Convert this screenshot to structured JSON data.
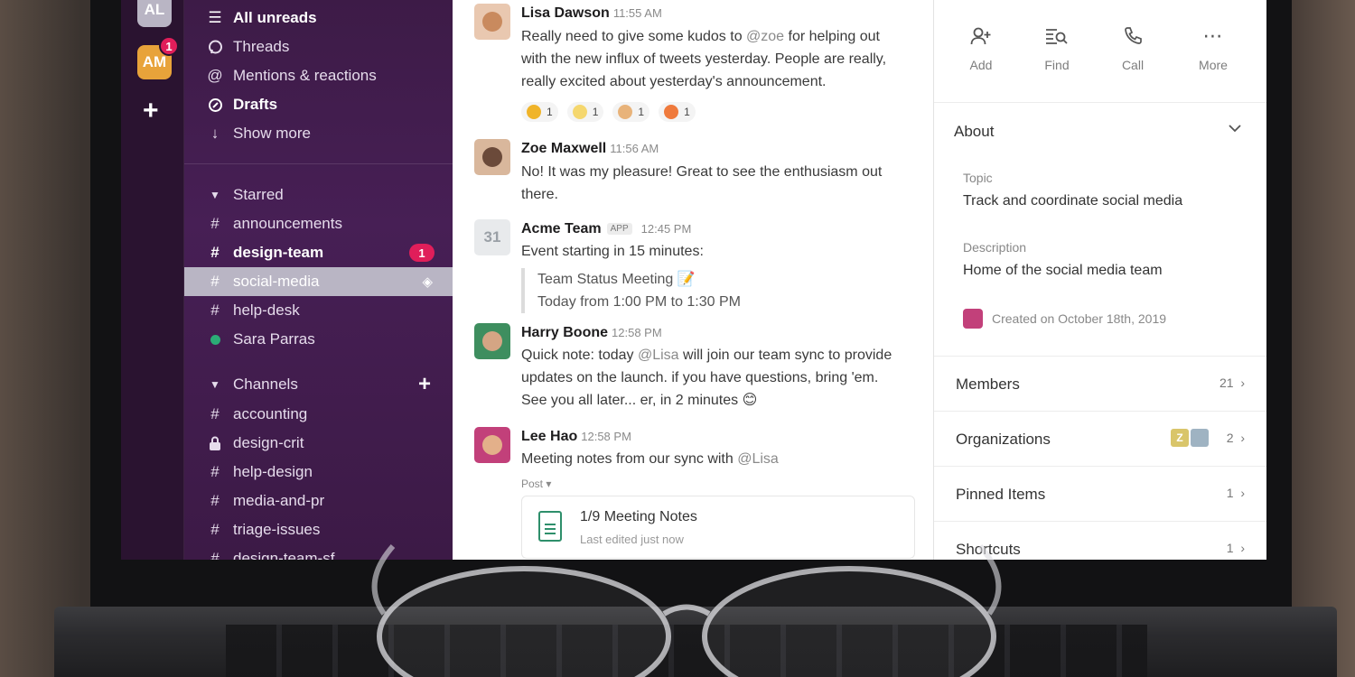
{
  "workspaces": [
    {
      "initials": "AL",
      "color": "#b9b5c4"
    },
    {
      "initials": "AM",
      "color": "#e8a33a",
      "badge": "1"
    }
  ],
  "rail": {
    "add_label": "+"
  },
  "sidebar": {
    "top_items": [
      {
        "label": "All unreads",
        "icon": "all-unreads-icon"
      },
      {
        "label": "Threads",
        "icon": "threads-icon"
      },
      {
        "label": "Mentions & reactions",
        "icon": "mentions-icon"
      },
      {
        "label": "Drafts",
        "icon": "drafts-icon"
      },
      {
        "label": "Show more",
        "icon": "arrow-down-icon"
      }
    ],
    "starred": {
      "title": "Starred",
      "items": [
        {
          "label": "announcements",
          "icon": "hash"
        },
        {
          "label": "design-team",
          "icon": "hash",
          "badge": "1"
        },
        {
          "label": "social-media",
          "icon": "hash",
          "active": true
        },
        {
          "label": "help-desk",
          "icon": "hash"
        },
        {
          "label": "Sara Parras",
          "icon": "presence"
        }
      ]
    },
    "channels": {
      "title": "Channels",
      "items": [
        {
          "label": "accounting",
          "icon": "hash"
        },
        {
          "label": "design-crit",
          "icon": "lock"
        },
        {
          "label": "help-design",
          "icon": "hash"
        },
        {
          "label": "media-and-pr",
          "icon": "hash"
        },
        {
          "label": "triage-issues",
          "icon": "hash"
        },
        {
          "label": "design-team-sf",
          "icon": "hash"
        }
      ]
    }
  },
  "messages": [
    {
      "author": "Lisa Dawson",
      "time": "11:55 AM",
      "text_lines": [
        "Really need to give some kudos to @zoe for helping out",
        "with the new influx of tweets yesterday. People are really,",
        "really excited about yesterday's announcement."
      ],
      "reactions": [
        {
          "emoji": "party-popper",
          "count": "1",
          "color": "#f0b429"
        },
        {
          "emoji": "sparkles",
          "count": "1",
          "color": "#f5d76e"
        },
        {
          "emoji": "clapping-hands",
          "count": "1",
          "color": "#e8b37a"
        },
        {
          "emoji": "heart-eyes",
          "count": "1",
          "color": "#ef7a3c"
        }
      ]
    },
    {
      "author": "Zoe Maxwell",
      "time": "11:56 AM",
      "text_lines": [
        "No! It was my pleasure! Great to see the enthusiasm out",
        "there."
      ]
    },
    {
      "author": "Acme Team",
      "tag": "APP",
      "time": "12:45 PM",
      "calendar_day": "31",
      "text_lines": [
        "Event starting in 15 minutes:"
      ],
      "quote_lines": [
        "Team Status Meeting 📝",
        "Today from 1:00 PM to 1:30 PM"
      ]
    },
    {
      "author": "Harry Boone",
      "time": "12:58 PM",
      "text_lines": [
        "Quick note: today @Lisa will join our team sync to provide",
        "updates on the launch. if you have questions, bring 'em.",
        "See you all later... er, in 2 minutes 😊"
      ]
    },
    {
      "author": "Lee Hao",
      "time": "12:58 PM",
      "text_lines": [
        "Meeting notes from our sync with @Lisa"
      ],
      "post_label": "Post ▾",
      "doc": {
        "title": "1/9 Meeting Notes",
        "subtitle": "Last edited just now"
      }
    }
  ],
  "details": {
    "actions": [
      {
        "label": "Add",
        "icon": "add-person-icon"
      },
      {
        "label": "Find",
        "icon": "find-icon"
      },
      {
        "label": "Call",
        "icon": "phone-icon"
      },
      {
        "label": "More",
        "icon": "more-icon"
      }
    ],
    "about": {
      "title": "About",
      "topic_label": "Topic",
      "topic_value": "Track and coordinate social media",
      "description_label": "Description",
      "description_value": "Home of the social media team",
      "created": "Created on October 18th, 2019"
    },
    "rows": [
      {
        "label": "Members",
        "count": "21"
      },
      {
        "label": "Organizations",
        "count": "2"
      },
      {
        "label": "Pinned Items",
        "count": "1"
      },
      {
        "label": "Shortcuts",
        "count": "1"
      }
    ]
  },
  "colors": {
    "sidebar_bg": "#471f55",
    "rail_bg": "#2a1330",
    "badge": "#e01e5a",
    "active_item": "#b9b5c4",
    "presence": "#2bac76"
  }
}
